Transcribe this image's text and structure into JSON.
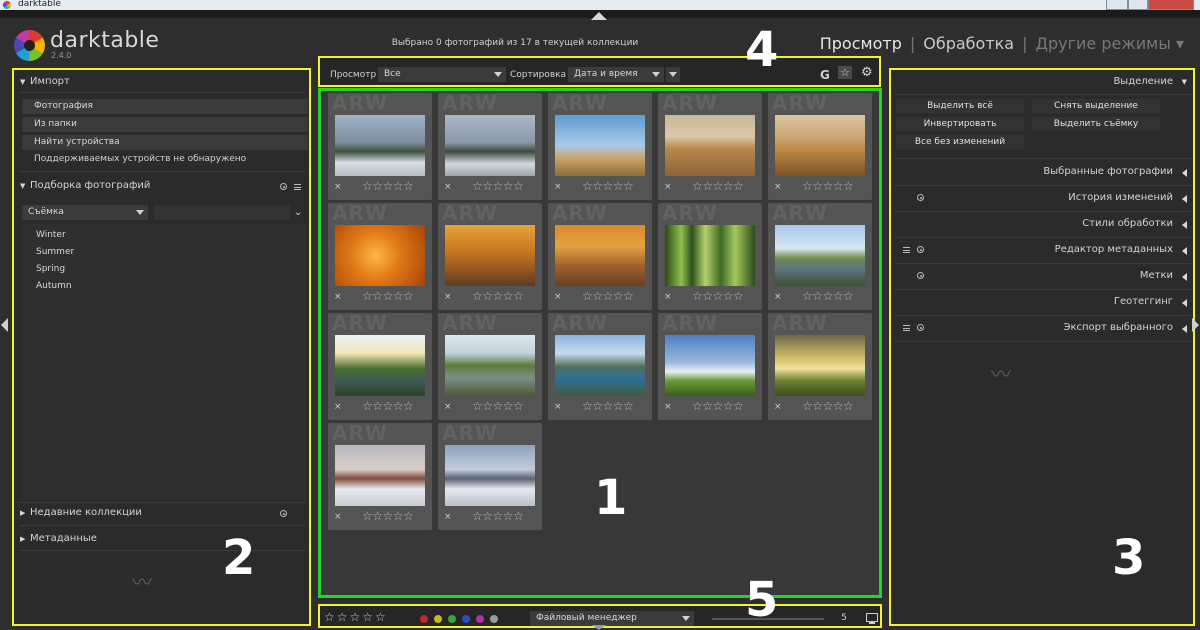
{
  "window": {
    "title": "darktable"
  },
  "app": {
    "name": "darktable",
    "version": "2.4.0"
  },
  "header": {
    "selection_status": "Выбрано 0 фотографий из 17 в текущей коллекции",
    "views": {
      "active": "Просмотр",
      "second": "Обработка",
      "other": "Другие режимы ▾",
      "separator": "|"
    }
  },
  "left_panel": {
    "import": {
      "title": "Импорт",
      "buttons": [
        "Фотография",
        "Из папки",
        "Найти устройства"
      ],
      "status": "Поддерживаемых устройств не обнаружено"
    },
    "collect": {
      "title": "Подборка фотографий",
      "property_combo": "Съёмка",
      "items": [
        "Winter",
        "Summer",
        "Spring",
        "Autumn"
      ]
    },
    "recent_collections": "Недавние коллекции",
    "metadata": "Метаданные"
  },
  "top_toolbar": {
    "view_label": "Просмотр",
    "view_value": "Все",
    "sort_label": "Сортировка",
    "sort_value": "Дата и время",
    "grouping_icon": "G"
  },
  "thumbnails": {
    "ext_label": "ARW",
    "reject_glyph": "×",
    "stars_glyph": "☆☆☆☆☆",
    "images": [
      {
        "id": "t1",
        "palette": "winter-bench"
      },
      {
        "id": "t2",
        "palette": "winter-bridge"
      },
      {
        "id": "t3",
        "palette": "autumn-tree-sky"
      },
      {
        "id": "t4",
        "palette": "field-road"
      },
      {
        "id": "t5",
        "palette": "hay-field"
      },
      {
        "id": "t6",
        "palette": "orange-leaf-macro"
      },
      {
        "id": "t7",
        "palette": "birch-road"
      },
      {
        "id": "t8",
        "palette": "autumn-road"
      },
      {
        "id": "t9",
        "palette": "pine-forest"
      },
      {
        "id": "t10",
        "palette": "lake-shore"
      },
      {
        "id": "t11",
        "palette": "river-sunset"
      },
      {
        "id": "t12",
        "palette": "lake-boat"
      },
      {
        "id": "t13",
        "palette": "mountain-lake"
      },
      {
        "id": "t14",
        "palette": "green-field-sky"
      },
      {
        "id": "t15",
        "palette": "sunset-tree"
      },
      {
        "id": "t16",
        "palette": "snow-tree"
      },
      {
        "id": "t17",
        "palette": "snow-fence"
      }
    ]
  },
  "bottom_toolbar": {
    "stars_glyph": "☆☆☆☆☆",
    "color_labels": [
      "#c3262b",
      "#c7bb22",
      "#3aa632",
      "#2f49c4",
      "#b032b0",
      "#9a9a9a"
    ],
    "layout_value": "Файловый менеджер",
    "zoom_value": "5"
  },
  "right_panel": {
    "select": {
      "title": "Выделение",
      "buttons": [
        "Выделить всё",
        "Снять выделение",
        "Инвертировать",
        "Выделить съёмку",
        "Все без изменений"
      ]
    },
    "sections": [
      "Выбранные фотографии",
      "История изменений",
      "Стили обработки",
      "Редактор метаданных",
      "Метки",
      "Геотеггинг",
      "Экспорт выбранного"
    ]
  },
  "callouts": [
    "1",
    "2",
    "3",
    "4",
    "5"
  ],
  "colors": {
    "yellow_outline": "#f3f32d",
    "green_outline": "#23d22d",
    "background": "#2e2e2e"
  }
}
